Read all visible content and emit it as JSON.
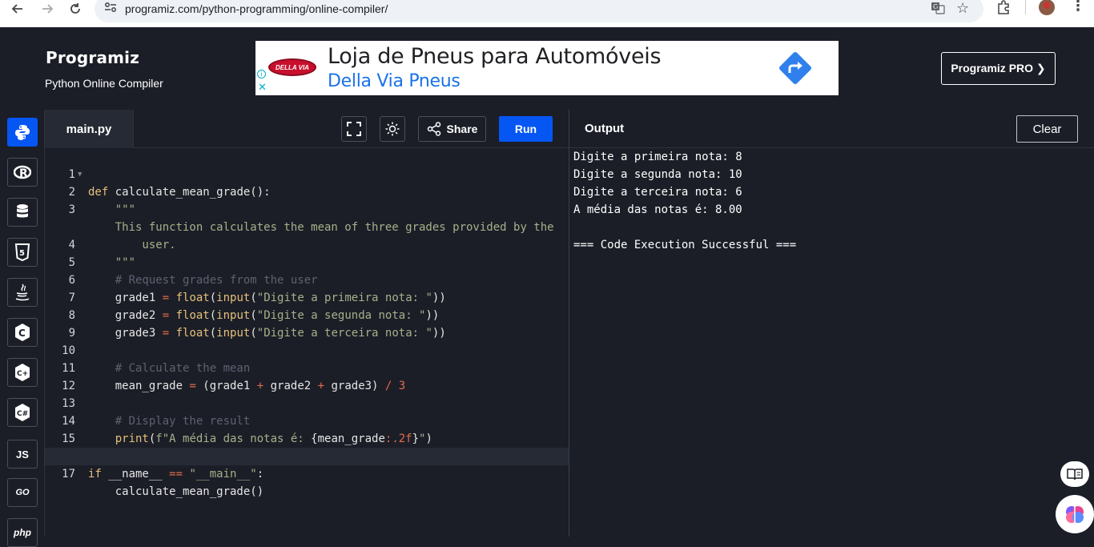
{
  "browser": {
    "url": "programiz.com/python-programming/online-compiler/"
  },
  "header": {
    "logo": "Programiz",
    "subtitle": "Python Online Compiler",
    "pro_button": "Programiz PRO ❯"
  },
  "ad": {
    "brand": "DELLA VIA",
    "title": "Loja de Pneus para Automóveis",
    "subtitle": "Della Via Pneus",
    "close": "✕",
    "info": "i"
  },
  "sidebar": {
    "items": [
      {
        "name": "python",
        "label": "",
        "active": true
      },
      {
        "name": "r",
        "label": "R"
      },
      {
        "name": "sql",
        "label": ""
      },
      {
        "name": "html",
        "label": "5"
      },
      {
        "name": "java",
        "label": ""
      },
      {
        "name": "c",
        "label": "C"
      },
      {
        "name": "cpp",
        "label": "C+"
      },
      {
        "name": "csharp",
        "label": "C#"
      },
      {
        "name": "js",
        "label": "JS"
      },
      {
        "name": "go",
        "label": "GO"
      },
      {
        "name": "php",
        "label": "php"
      }
    ]
  },
  "editor": {
    "file_name": "main.py",
    "share_label": "Share",
    "run_label": "Run"
  },
  "output": {
    "title": "Output",
    "clear_label": "Clear",
    "lines": [
      "Digite a primeira nota: 8",
      "Digite a segunda nota: 10",
      "Digite a terceira nota: 6",
      "A média das notas é: 8.00",
      "",
      "=== Code Execution Successful ==="
    ]
  },
  "code": {
    "line_numbers": [
      "1",
      "2",
      "3",
      "",
      "4",
      "5",
      "6",
      "7",
      "8",
      "9",
      "10",
      "11",
      "12",
      "13",
      "14",
      "15",
      "16",
      "17"
    ],
    "l1_kw": "def",
    "l1_rest": " calculate_mean_grade():",
    "l2": "    \"\"\"",
    "l3a": "    This function calculates the mean of three grades provided by the",
    "l3b": "        user.",
    "l4": "    \"\"\"",
    "l5": "    # Request grades from the user",
    "l6_var": "    grade1 ",
    "l6_eq": "=",
    "l6_fn": " float",
    "l6_p1": "(",
    "l6_fn2": "input",
    "l6_p2": "(",
    "l6_str": "\"Digite a primeira nota: \"",
    "l6_end": "))",
    "l7_var": "    grade2 ",
    "l7_eq": "=",
    "l7_fn": " float",
    "l7_p1": "(",
    "l7_fn2": "input",
    "l7_p2": "(",
    "l7_str": "\"Digite a segunda nota: \"",
    "l7_end": "))",
    "l8_var": "    grade3 ",
    "l8_eq": "=",
    "l8_fn": " float",
    "l8_p1": "(",
    "l8_fn2": "input",
    "l8_p2": "(",
    "l8_str": "\"Digite a terceira nota: \"",
    "l8_end": "))",
    "l10": "    # Calculate the mean",
    "l11_a": "    mean_grade ",
    "l11_eq": "=",
    "l11_b": " (grade1 ",
    "l11_p1": "+",
    "l11_c": " grade2 ",
    "l11_p2": "+",
    "l11_d": " grade3) ",
    "l11_div": "/",
    "l11_sp": " ",
    "l11_n": "3",
    "l13": "    # Display the result",
    "l14_fn": "    print",
    "l14_p": "(",
    "l14_s1": "f\"A média das notas é: ",
    "l14_v": "{mean_grade",
    "l14_fmt": ":.2f",
    "l14_b": "}",
    "l14_s2": "\"",
    "l14_end": ")",
    "l16_kw": "if",
    "l16_a": " __name__ ",
    "l16_eq": "==",
    "l16_sp": " ",
    "l16_s": "\"__main__\"",
    "l16_c": ":",
    "l17": "    calculate_mean_grade()"
  }
}
